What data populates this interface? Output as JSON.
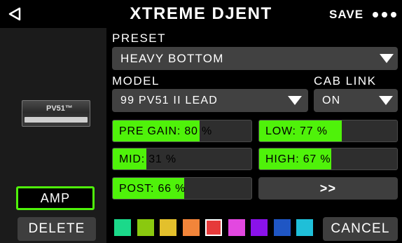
{
  "header": {
    "title": "XTREME DJENT",
    "save_label": "SAVE",
    "back_icon": "back-triangle-icon",
    "more_icon": "more-dots-icon"
  },
  "preset": {
    "label": "PRESET",
    "value": "HEAVY BOTTOM"
  },
  "model": {
    "label": "MODEL",
    "value": "99 PV51 II LEAD"
  },
  "cab_link": {
    "label": "CAB LINK",
    "value": "ON"
  },
  "amp_image": {
    "brand": "PV51™"
  },
  "params": {
    "pre_gain": {
      "text": "PRE GAIN: 80 %",
      "value": 80
    },
    "low": {
      "text": "LOW: 77 %",
      "value": 77
    },
    "mid": {
      "text": "MID: 31 %",
      "value": 31
    },
    "high": {
      "text": "HIGH: 67 %",
      "value": 67
    },
    "post": {
      "text": "POST: 66 %",
      "value": 66
    }
  },
  "next_label": ">>",
  "amp_label": "AMP",
  "delete_label": "DELETE",
  "cancel_label": "CANCEL",
  "colors": {
    "accent_green": "#4ff20a",
    "swatches": [
      "#1bd98a",
      "#8ac90f",
      "#e3c02c",
      "#f2853a",
      "#e63a3a",
      "#e348e0",
      "#8a12ea",
      "#1f56c4",
      "#1fbfd8"
    ],
    "selected_swatch": 4
  }
}
